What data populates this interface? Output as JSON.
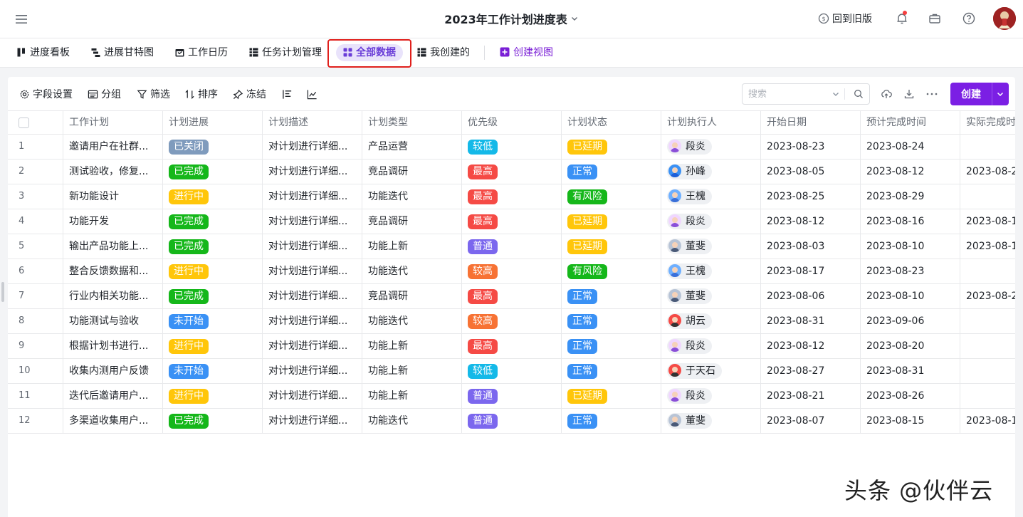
{
  "header": {
    "title": "2023年工作计划进度表",
    "back_old": "回到旧版"
  },
  "tabs": [
    {
      "label": "进度看板",
      "icon": "kanban-icon"
    },
    {
      "label": "进展甘特图",
      "icon": "gantt-icon"
    },
    {
      "label": "工作日历",
      "icon": "calendar-icon"
    },
    {
      "label": "任务计划管理",
      "icon": "grid-icon"
    },
    {
      "label": "全部数据",
      "icon": "grid-icon",
      "active": true
    },
    {
      "label": "我创建的",
      "icon": "grid-icon"
    },
    {
      "label": "创建视图",
      "icon": "plus-square-icon"
    }
  ],
  "toolbar": {
    "field_settings": "字段设置",
    "group": "分组",
    "filter": "筛选",
    "sort": "排序",
    "freeze": "冻结",
    "search_placeholder": "搜索",
    "create_label": "创建"
  },
  "table": {
    "columns": [
      "工作计划",
      "计划进展",
      "计划描述",
      "计划类型",
      "优先级",
      "计划状态",
      "计划执行人",
      "开始日期",
      "预计完成时间",
      "实际完成时间"
    ],
    "rows": [
      {
        "no": "1",
        "plan": "邀请用户在社群...",
        "progress": "已关闭",
        "desc": "对计划进行详细...",
        "type": "产品运营",
        "priority": "较低",
        "status": "已延期",
        "owner": "段炎",
        "start": "2023-08-23",
        "due": "2023-08-24",
        "actual": ""
      },
      {
        "no": "2",
        "plan": "测试验收，修复...",
        "progress": "已完成",
        "desc": "对计划进行详细...",
        "type": "竞品调研",
        "priority": "最高",
        "status": "正常",
        "owner": "孙峰",
        "start": "2023-08-05",
        "due": "2023-08-12",
        "actual": "2023-08-2"
      },
      {
        "no": "3",
        "plan": "新功能设计",
        "progress": "进行中",
        "desc": "对计划进行详细...",
        "type": "功能迭代",
        "priority": "最高",
        "status": "有风险",
        "owner": "王槐",
        "start": "2023-08-25",
        "due": "2023-08-29",
        "actual": ""
      },
      {
        "no": "4",
        "plan": "功能开发",
        "progress": "已完成",
        "desc": "对计划进行详细...",
        "type": "竞品调研",
        "priority": "最高",
        "status": "已延期",
        "owner": "段炎",
        "start": "2023-08-12",
        "due": "2023-08-16",
        "actual": "2023-08-1"
      },
      {
        "no": "5",
        "plan": "输出产品功能上...",
        "progress": "已完成",
        "desc": "对计划进行详细...",
        "type": "功能上新",
        "priority": "普通",
        "status": "已延期",
        "owner": "董斐",
        "start": "2023-08-03",
        "due": "2023-08-10",
        "actual": "2023-08-1"
      },
      {
        "no": "6",
        "plan": "整合反馈数据和...",
        "progress": "进行中",
        "desc": "对计划进行详细...",
        "type": "功能迭代",
        "priority": "较高",
        "status": "有风险",
        "owner": "王槐",
        "start": "2023-08-17",
        "due": "2023-08-23",
        "actual": ""
      },
      {
        "no": "7",
        "plan": "行业内相关功能...",
        "progress": "已完成",
        "desc": "对计划进行详细...",
        "type": "竞品调研",
        "priority": "最高",
        "status": "正常",
        "owner": "董斐",
        "start": "2023-08-06",
        "due": "2023-08-10",
        "actual": "2023-08-2"
      },
      {
        "no": "8",
        "plan": "功能测试与验收",
        "progress": "未开始",
        "desc": "对计划进行详细...",
        "type": "功能迭代",
        "priority": "较高",
        "status": "正常",
        "owner": "胡云",
        "start": "2023-08-31",
        "due": "2023-09-06",
        "actual": ""
      },
      {
        "no": "9",
        "plan": "根据计划书进行...",
        "progress": "进行中",
        "desc": "对计划进行详细...",
        "type": "功能上新",
        "priority": "最高",
        "status": "正常",
        "owner": "段炎",
        "start": "2023-08-12",
        "due": "2023-08-20",
        "actual": ""
      },
      {
        "no": "10",
        "plan": "收集内测用户反馈",
        "progress": "未开始",
        "desc": "对计划进行详细...",
        "type": "功能上新",
        "priority": "较低",
        "status": "正常",
        "owner": "于天石",
        "start": "2023-08-27",
        "due": "2023-08-31",
        "actual": ""
      },
      {
        "no": "11",
        "plan": "迭代后邀请用户...",
        "progress": "进行中",
        "desc": "对计划进行详细...",
        "type": "功能上新",
        "priority": "普通",
        "status": "已延期",
        "owner": "段炎",
        "start": "2023-08-21",
        "due": "2023-08-26",
        "actual": ""
      },
      {
        "no": "12",
        "plan": "多渠道收集用户...",
        "progress": "已完成",
        "desc": "对计划进行详细...",
        "type": "功能迭代",
        "priority": "普通",
        "status": "正常",
        "owner": "董斐",
        "start": "2023-08-07",
        "due": "2023-08-15",
        "actual": "2023-08-1"
      }
    ]
  },
  "colors": {
    "已关闭": "#7f9bbd",
    "已完成": "#15b71a",
    "进行中": "#ffc60a",
    "未开始": "#3a91f5",
    "较低": "#14b9e8",
    "最高": "#f54a45",
    "普通": "#7b67ee",
    "较高": "#f77234",
    "已延期": "#ffc60a",
    "正常": "#3a91f5",
    "有风险": "#15b71a",
    "accent": "#7b1fe4"
  },
  "watermark": "头条 @伙伴云"
}
